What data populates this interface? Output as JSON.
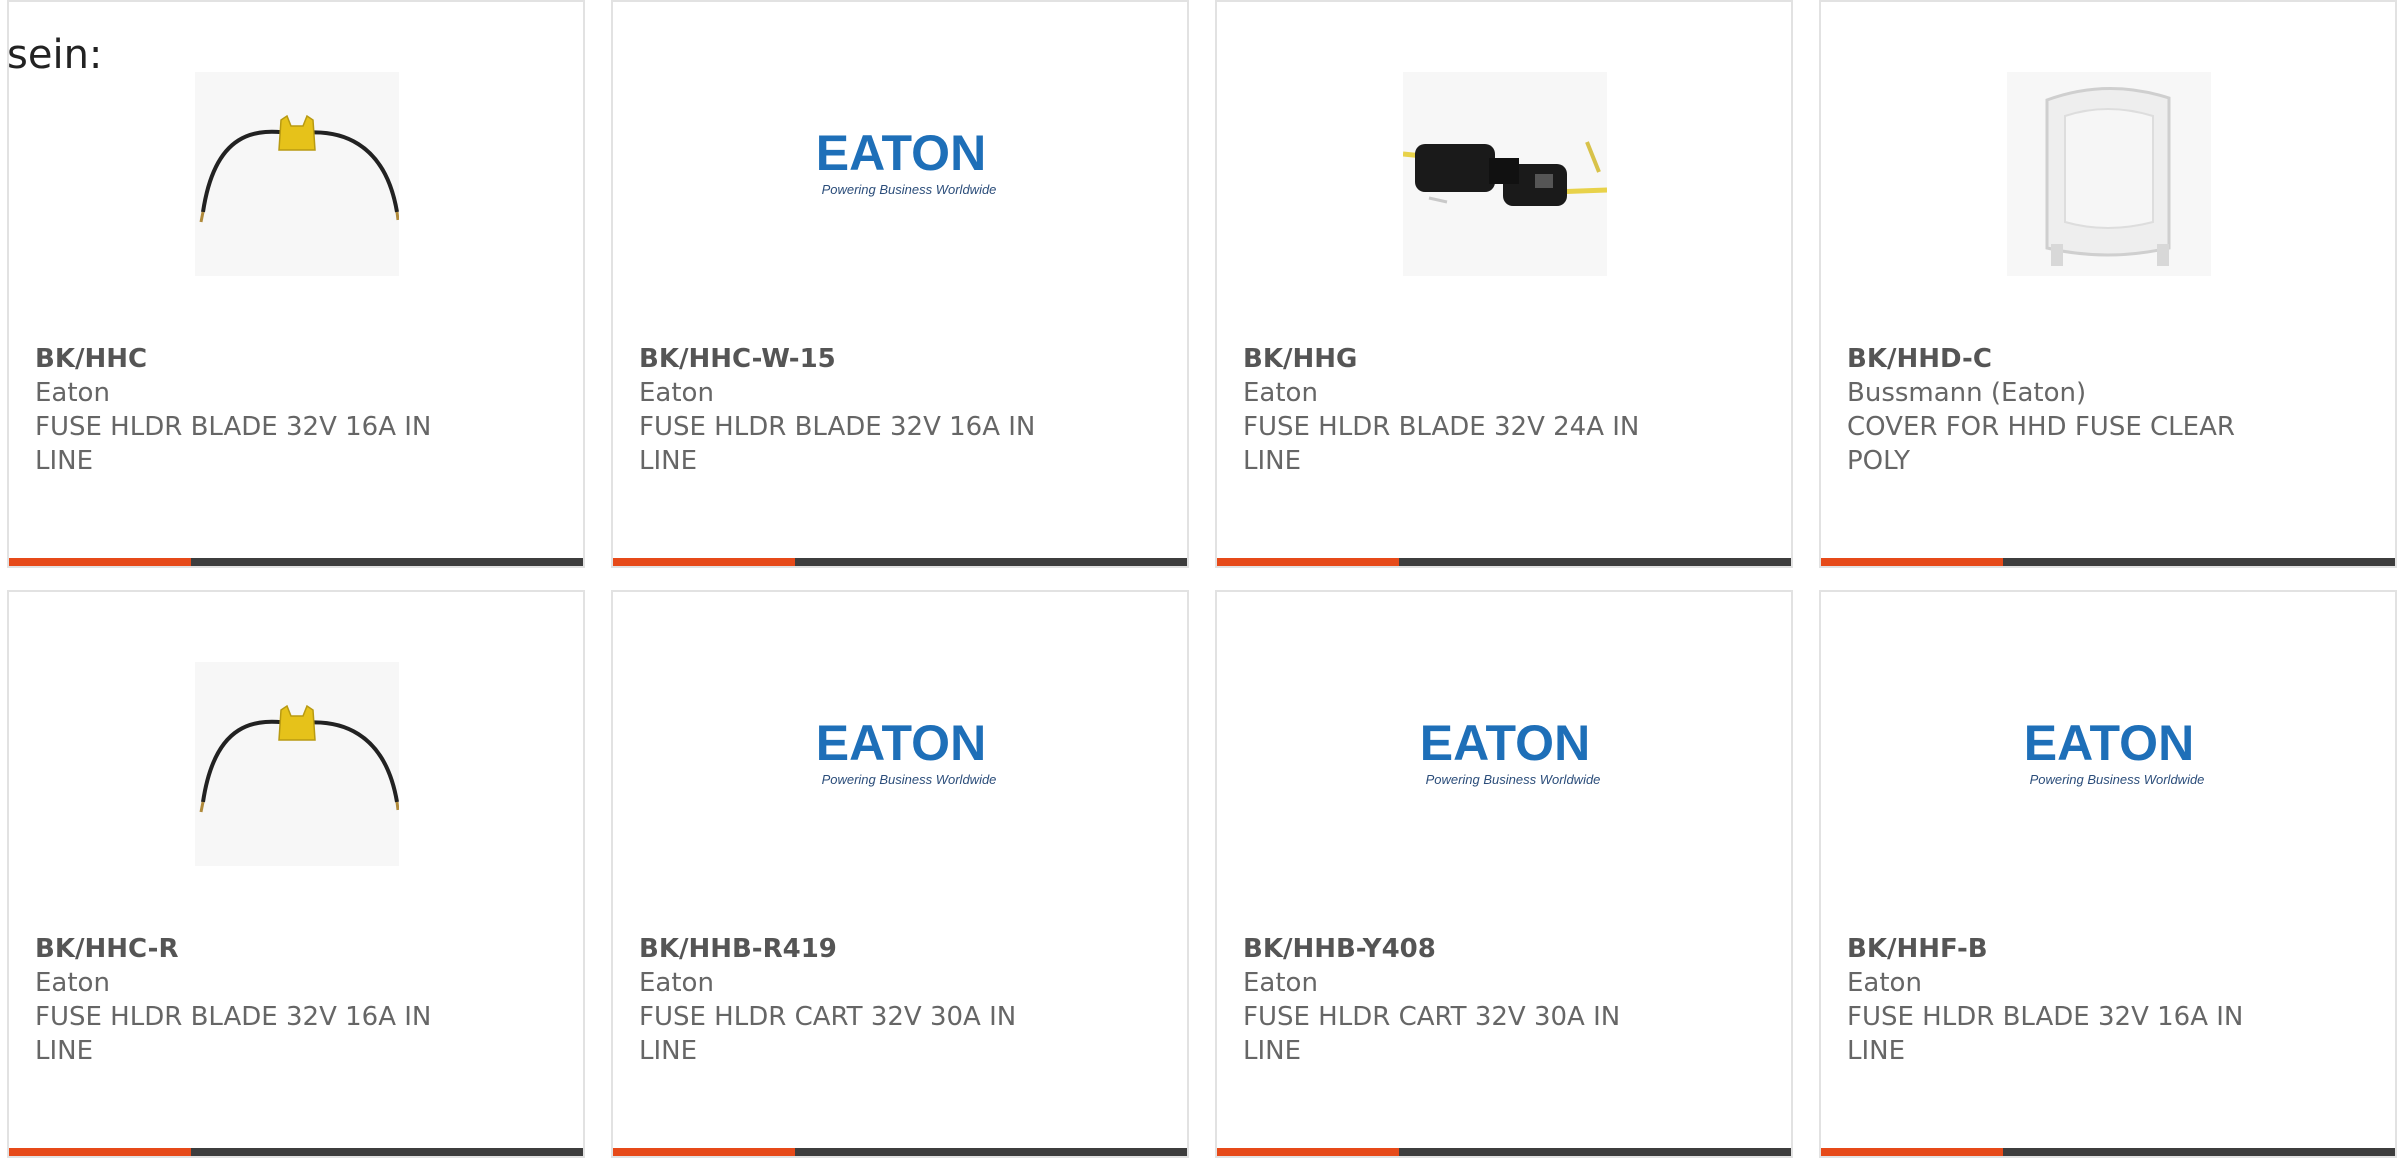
{
  "intro_text": "sein:",
  "colors": {
    "accent": "#e64a19",
    "bar_dark": "#3d3d3d",
    "eaton_blue": "#1e6fb8",
    "border": "#e2e2e2"
  },
  "products": [
    {
      "part": "BK/HHC",
      "manufacturer": "Eaton",
      "description": "FUSE HLDR BLADE 32V 16A IN LINE",
      "image": "inline-fuse-holder-yellow-photo"
    },
    {
      "part": "BK/HHC-W-15",
      "manufacturer": "Eaton",
      "description": "FUSE HLDR BLADE 32V 16A IN LINE",
      "image": "eaton-logo",
      "logo_text": "EATON",
      "logo_tagline": "Powering Business Worldwide"
    },
    {
      "part": "BK/HHG",
      "manufacturer": "Eaton",
      "description": "FUSE HLDR BLADE 32V 24A IN LINE",
      "image": "black-fuse-holder-photo"
    },
    {
      "part": "BK/HHD-C",
      "manufacturer": "Bussmann (Eaton)",
      "description": "COVER FOR HHD FUSE CLEAR POLY",
      "image": "clear-cover-photo"
    },
    {
      "part": "BK/HHC-R",
      "manufacturer": "Eaton",
      "description": "FUSE HLDR BLADE 32V 16A IN LINE",
      "image": "inline-fuse-holder-yellow-photo"
    },
    {
      "part": "BK/HHB-R419",
      "manufacturer": "Eaton",
      "description": "FUSE HLDR CART 32V 30A IN LINE",
      "image": "eaton-logo",
      "logo_text": "EATON",
      "logo_tagline": "Powering Business Worldwide"
    },
    {
      "part": "BK/HHB-Y408",
      "manufacturer": "Eaton",
      "description": "FUSE HLDR CART 32V 30A IN LINE",
      "image": "eaton-logo",
      "logo_text": "EATON",
      "logo_tagline": "Powering Business Worldwide"
    },
    {
      "part": "BK/HHF-B",
      "manufacturer": "Eaton",
      "description": "FUSE HLDR BLADE 32V 16A IN LINE",
      "image": "eaton-logo",
      "logo_text": "EATON",
      "logo_tagline": "Powering Business Worldwide"
    }
  ]
}
